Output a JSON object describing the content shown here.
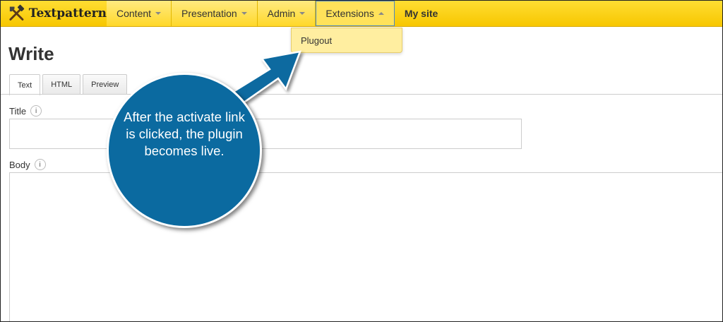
{
  "app": {
    "name": "Textpattern",
    "logo_icon": "crossed-tools-icon"
  },
  "nav": {
    "items": [
      {
        "label": "Content",
        "has_caret": true
      },
      {
        "label": "Presentation",
        "has_caret": true
      },
      {
        "label": "Admin",
        "has_caret": true
      },
      {
        "label": "Extensions",
        "has_caret": true,
        "active": true
      },
      {
        "label": "My site",
        "has_caret": false
      }
    ],
    "dropdown": {
      "items": [
        "Plugout"
      ]
    }
  },
  "page": {
    "title": "Write"
  },
  "tabs": [
    {
      "label": "Text",
      "active": true
    },
    {
      "label": "HTML",
      "active": false
    },
    {
      "label": "Preview",
      "active": false
    }
  ],
  "fields": {
    "title_label": "Title",
    "body_label": "Body",
    "info_glyph": "i"
  },
  "callout": {
    "text": "After the activate link is clicked, the plugin becomes live.",
    "color": "#0b6aa0"
  },
  "colors": {
    "nav_bg": "#f7c700",
    "dropdown_bg": "#ffeea0",
    "active_outline": "#4a86c5"
  }
}
